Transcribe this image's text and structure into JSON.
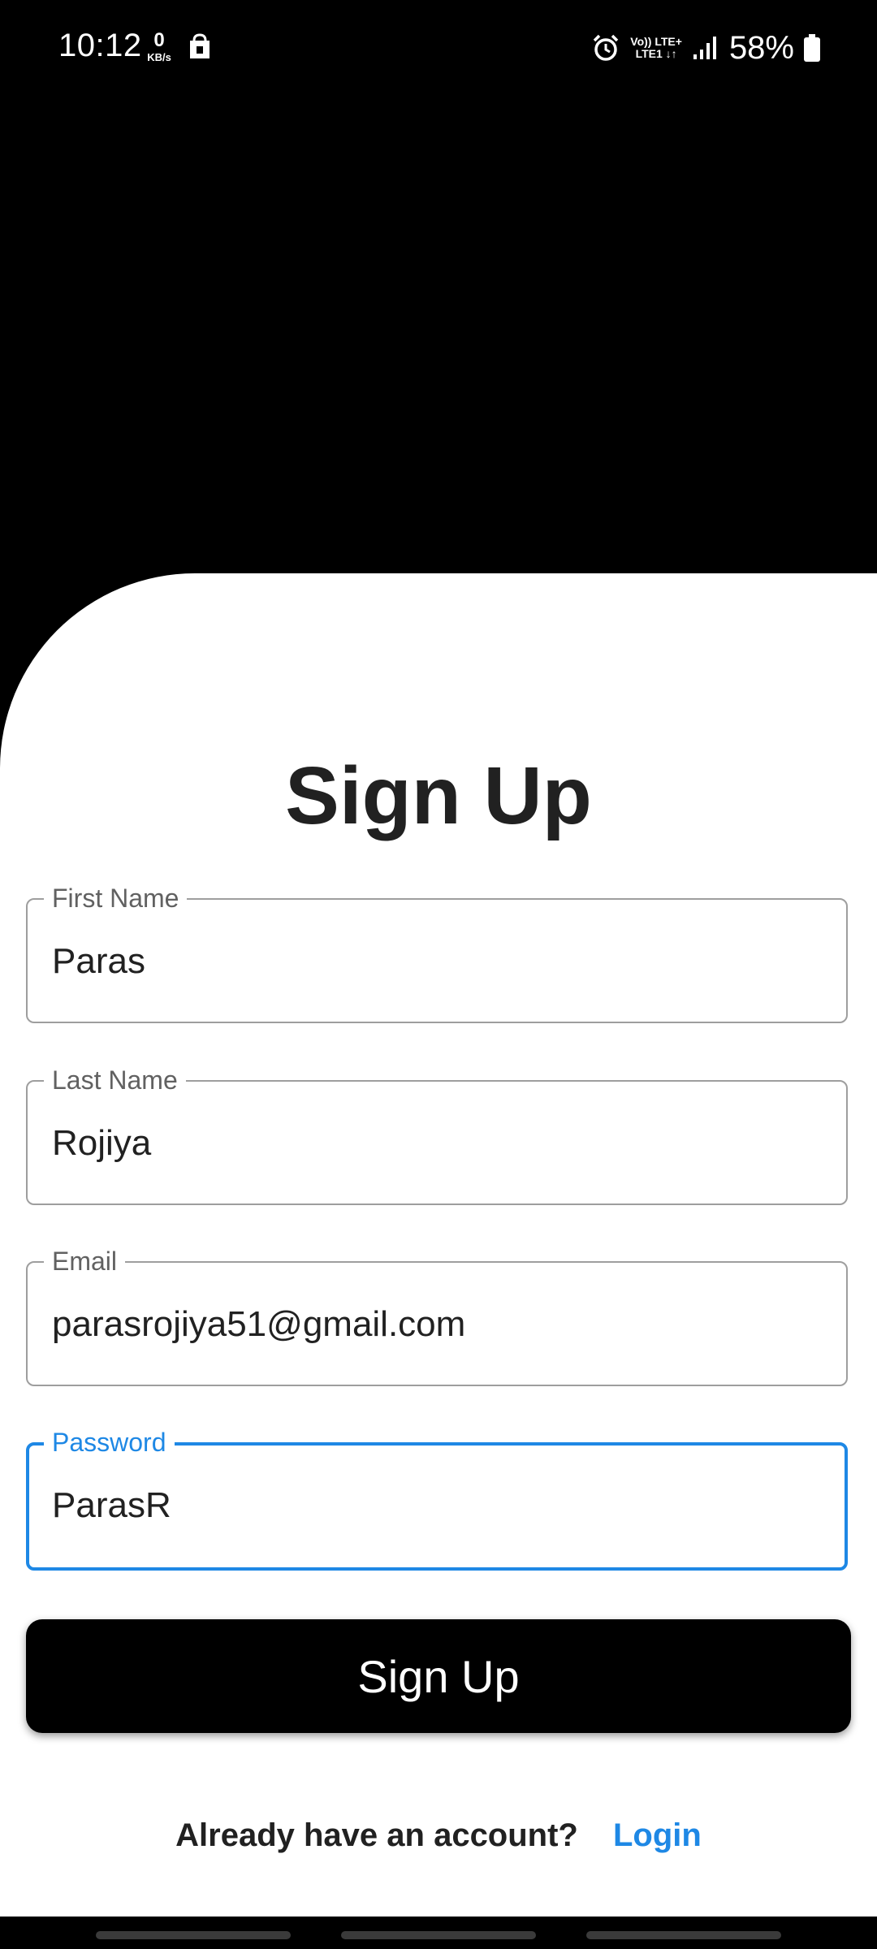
{
  "status_bar": {
    "time": "10:12",
    "net_speed_value": "0",
    "net_speed_unit": "KB/s",
    "volte_top": "Vo)) LTE+",
    "volte_bottom": "LTE1 ↓↑",
    "battery": "58%",
    "icons": [
      "app-notification-icon",
      "alarm-icon",
      "signal-icon",
      "battery-icon"
    ]
  },
  "form": {
    "title": "Sign Up",
    "first_name": {
      "label": "First Name",
      "value": "Paras"
    },
    "last_name": {
      "label": "Last Name",
      "value": "Rojiya"
    },
    "email": {
      "label": "Email",
      "value": "parasrojiya51@gmail.com"
    },
    "password": {
      "label": "Password",
      "value": "ParasR"
    },
    "submit_label": "Sign Up"
  },
  "footer": {
    "prompt": "Already have an account?",
    "login_link": "Login"
  },
  "colors": {
    "accent": "#1e88e5",
    "header_bg": "#000000",
    "card_bg": "#ffffff"
  }
}
